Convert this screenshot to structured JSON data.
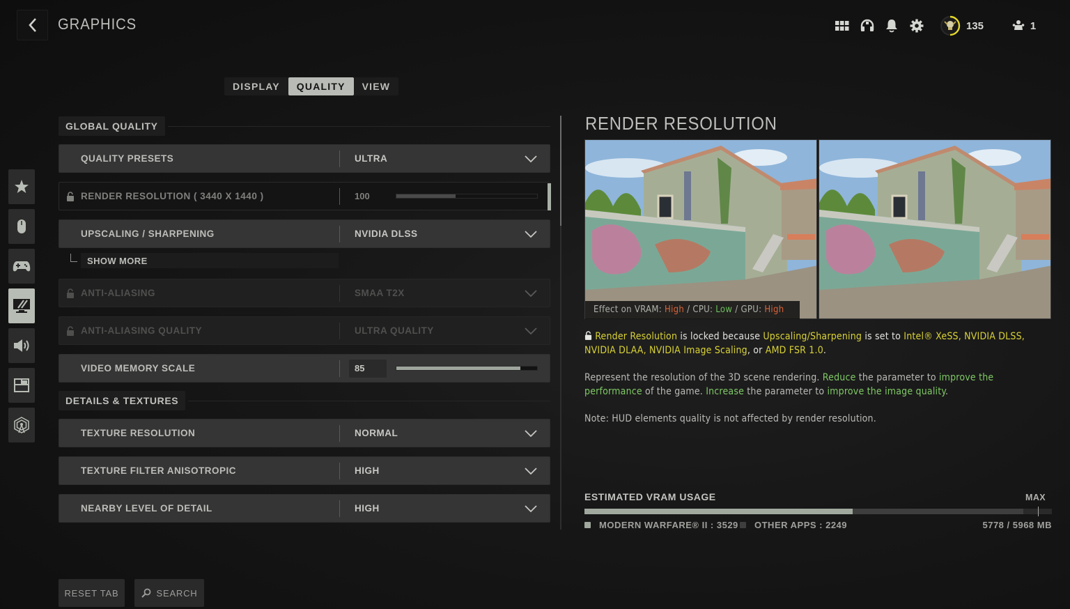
{
  "header": {
    "title": "GRAPHICS",
    "level": "135",
    "party_count": "1",
    "icons": [
      "back-icon",
      "apps-grid-icon",
      "headset-icon",
      "bell-icon",
      "gear-icon",
      "rank-emblem-icon",
      "party-icon"
    ]
  },
  "tabs": [
    {
      "label": "DISPLAY",
      "active": false
    },
    {
      "label": "QUALITY",
      "active": true
    },
    {
      "label": "VIEW",
      "active": false
    }
  ],
  "sidenav": [
    {
      "icon": "star-icon",
      "active": false
    },
    {
      "icon": "mouse-icon",
      "active": false
    },
    {
      "icon": "gamepad-icon",
      "active": false
    },
    {
      "icon": "monitor-icon",
      "active": true
    },
    {
      "icon": "speaker-icon",
      "active": false
    },
    {
      "icon": "interface-layout-icon",
      "active": false
    },
    {
      "icon": "network-tower-icon",
      "active": false
    }
  ],
  "sections": {
    "global_quality": "GLOBAL QUALITY",
    "details_textures": "DETAILS & TEXTURES"
  },
  "settings": {
    "quality_presets": {
      "label": "QUALITY PRESETS",
      "value": "ULTRA"
    },
    "render_resolution": {
      "label": "RENDER RESOLUTION ( 3440 X 1440 )",
      "value": "100",
      "fill_fraction": 0.42,
      "locked": true
    },
    "upscaling": {
      "label": "UPSCALING / SHARPENING",
      "value": "NVIDIA DLSS"
    },
    "show_more": "SHOW MORE",
    "anti_aliasing": {
      "label": "ANTI-ALIASING",
      "value": "SMAA T2X",
      "locked": true
    },
    "anti_aliasing_quality": {
      "label": "ANTI-ALIASING QUALITY",
      "value": "ULTRA QUALITY",
      "locked": true
    },
    "video_memory_scale": {
      "label": "VIDEO MEMORY SCALE",
      "value": "85",
      "fill_fraction": 0.88
    },
    "texture_resolution": {
      "label": "TEXTURE RESOLUTION",
      "value": "NORMAL"
    },
    "texture_filter": {
      "label": "TEXTURE FILTER ANISOTROPIC",
      "value": "HIGH"
    },
    "nearby_lod": {
      "label": "NEARBY LEVEL OF DETAIL",
      "value": "HIGH"
    }
  },
  "detail": {
    "title": "RENDER RESOLUTION",
    "effect": {
      "vram_label": "Effect on VRAM: ",
      "vram": "High",
      "sep1": " / ",
      "cpu_label": "CPU: ",
      "cpu": "Low",
      "sep2": " / ",
      "gpu_label": "GPU: ",
      "gpu": "High"
    },
    "locked_note": {
      "p1": "Render Resolution",
      "p2": " is locked because ",
      "p3": "Upscaling/Sharpening",
      "p4": " is set to ",
      "p5": "Intel® XeSS, NVIDIA DLSS, NVIDIA DLAA, NVIDIA Image Scaling",
      "p6": ", or ",
      "p7": "AMD FSR 1.0",
      "p8": "."
    },
    "description": {
      "p1": "Represent the resolution of the 3D scene rendering. ",
      "p2": "Reduce",
      "p3": " the parameter to ",
      "p4": "improve the performance",
      "p5": " of the game. ",
      "p6": "Increase",
      "p7": " the parameter to ",
      "p8": "improve the image quality",
      "p9": "."
    },
    "note": "Note: HUD elements quality is not affected by render resolution."
  },
  "vram": {
    "title": "ESTIMATED VRAM USAGE",
    "max_label": "MAX",
    "game_label": "MODERN WARFARE® II : 3529",
    "other_label": "OTHER APPS : 2249",
    "total": "5778 / 5968 MB",
    "game_mb": 3529,
    "other_mb": 2249,
    "max_mb": 5968
  },
  "footer": {
    "reset_label": "RESET TAB",
    "search_label": "SEARCH"
  }
}
